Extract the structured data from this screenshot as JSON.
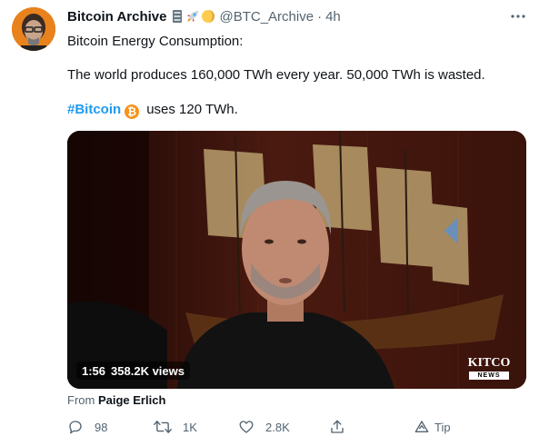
{
  "author": {
    "name": "Bitcoin Archive",
    "badges": [
      "server-icon",
      "rocket-icon",
      "moon-icon"
    ],
    "handle": "@BTC_Archive",
    "separator": "·",
    "time": "4h"
  },
  "tweet": {
    "line1": "Bitcoin Energy Consumption:",
    "line2": "The world produces 160,000 TWh every year. 50,000 TWh is wasted.",
    "hashtag": "#Bitcoin",
    "coin_symbol": "₿",
    "line3_rest": "uses 120 TWh."
  },
  "media": {
    "duration": "1:56",
    "views": "358.2K views",
    "brand": "KITCO",
    "brand_sub": "NEWS"
  },
  "source": {
    "prefix": "From",
    "name": "Paige Erlich"
  },
  "actions": {
    "replies": "98",
    "retweets": "1K",
    "likes": "2.8K",
    "tip": "Tip"
  },
  "colors": {
    "accent": "#1d9bf0",
    "muted": "#536471",
    "bitcoin": "#f7931a"
  }
}
